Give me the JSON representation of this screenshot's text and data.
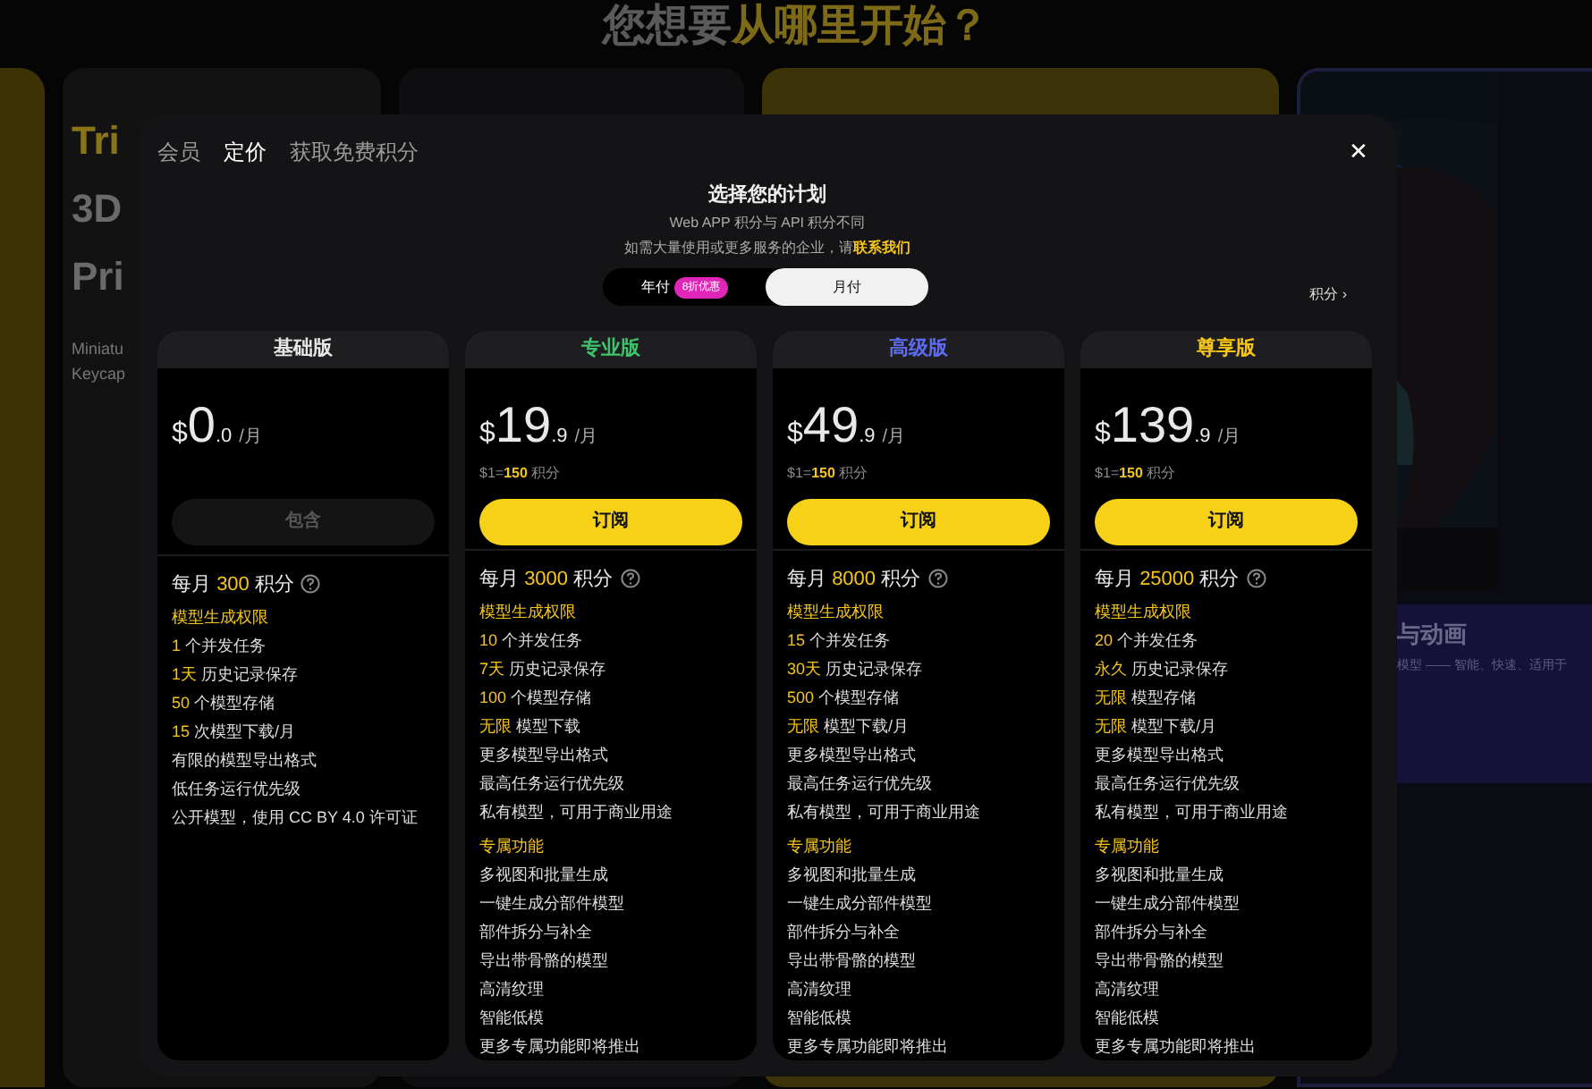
{
  "backdrop": {
    "heading": {
      "plain": "您想要",
      "highlight": "从哪里开始？"
    },
    "promo_lines": [
      "Tri",
      "3D",
      "Pri"
    ],
    "promo_caption": [
      "Miniatu",
      "Keycap"
    ],
    "feature_title": "与动画",
    "feature_subtitle": "模型 —— 智能、快速、适用于"
  },
  "modal": {
    "tabs": [
      {
        "label": "会员",
        "selected": false
      },
      {
        "label": "定价",
        "selected": true
      },
      {
        "label": "获取免费积分",
        "selected": false
      }
    ],
    "close": "✕",
    "title": "选择您的计划",
    "subtitle": "Web APP 积分与 API 积分不同",
    "contact": {
      "text": "如需大量使用或更多服务的企业，请",
      "link": "联系我们"
    },
    "billing": [
      {
        "label": "年付",
        "badge": "8折优惠",
        "selected": false
      },
      {
        "label": "月付",
        "selected": true
      }
    ],
    "credits_link": "积分 ›",
    "plans": [
      {
        "name": "基础版",
        "color": "#e6e6e6",
        "currency": "$",
        "price": "0",
        "decimals": ".0",
        "period": "/月",
        "button": {
          "label": "包含",
          "disabled": true
        },
        "features": [
          {
            "kind": "credits",
            "prefix": "每月",
            "value": "300",
            "suffix": "积分"
          },
          {
            "kind": "heading",
            "text": "模型生成权限"
          },
          {
            "kind": "feature",
            "value": "1",
            "text": "个并发任务"
          },
          {
            "kind": "feature",
            "value": "1天",
            "text": "历史记录保存"
          },
          {
            "kind": "feature",
            "value": "50",
            "text": "个模型存储"
          },
          {
            "kind": "feature",
            "value": "15",
            "text": "次模型下载/月"
          },
          {
            "kind": "feature",
            "text": "有限的模型导出格式"
          },
          {
            "kind": "feature",
            "text": "低任务运行优先级"
          },
          {
            "kind": "feature",
            "text": "公开模型，使用 CC BY 4.0 许可证"
          }
        ]
      },
      {
        "name": "专业版",
        "color": "#3ec36b",
        "currency": "$",
        "price": "19",
        "decimals": ".9",
        "period": "/月",
        "rate": {
          "prefix": "$1=",
          "value": "150",
          "suffix": "积分"
        },
        "button": {
          "label": "订阅",
          "disabled": false
        },
        "features": [
          {
            "kind": "credits",
            "prefix": "每月",
            "value": "3000",
            "suffix": "积分"
          },
          {
            "kind": "heading",
            "text": "模型生成权限"
          },
          {
            "kind": "feature",
            "value": "10",
            "text": "个并发任务"
          },
          {
            "kind": "feature",
            "value": "7天",
            "text": "历史记录保存"
          },
          {
            "kind": "feature",
            "value": "100",
            "text": "个模型存储"
          },
          {
            "kind": "feature",
            "value": "无限",
            "text": "模型下载"
          },
          {
            "kind": "feature",
            "text": "更多模型导出格式"
          },
          {
            "kind": "feature",
            "text": "最高任务运行优先级"
          },
          {
            "kind": "feature",
            "text": "私有模型，可用于商业用途"
          },
          {
            "kind": "heading",
            "text": "专属功能"
          },
          {
            "kind": "feature",
            "text": "多视图和批量生成"
          },
          {
            "kind": "feature",
            "text": "一键生成分部件模型"
          },
          {
            "kind": "feature",
            "text": "部件拆分与补全"
          },
          {
            "kind": "feature",
            "text": "导出带骨骼的模型"
          },
          {
            "kind": "feature",
            "text": "高清纹理"
          },
          {
            "kind": "feature",
            "text": "智能低模"
          },
          {
            "kind": "feature",
            "text": "更多专属功能即将推出"
          }
        ]
      },
      {
        "name": "高级版",
        "color": "#5d6cf0",
        "currency": "$",
        "price": "49",
        "decimals": ".9",
        "period": "/月",
        "rate": {
          "prefix": "$1=",
          "value": "150",
          "suffix": "积分"
        },
        "button": {
          "label": "订阅",
          "disabled": false
        },
        "features": [
          {
            "kind": "credits",
            "prefix": "每月",
            "value": "8000",
            "suffix": "积分"
          },
          {
            "kind": "heading",
            "text": "模型生成权限"
          },
          {
            "kind": "feature",
            "value": "15",
            "text": "个并发任务"
          },
          {
            "kind": "feature",
            "value": "30天",
            "text": "历史记录保存"
          },
          {
            "kind": "feature",
            "value": "500",
            "text": "个模型存储"
          },
          {
            "kind": "feature",
            "value": "无限",
            "text": "模型下载/月"
          },
          {
            "kind": "feature",
            "text": "更多模型导出格式"
          },
          {
            "kind": "feature",
            "text": "最高任务运行优先级"
          },
          {
            "kind": "feature",
            "text": "私有模型，可用于商业用途"
          },
          {
            "kind": "heading",
            "text": "专属功能"
          },
          {
            "kind": "feature",
            "text": "多视图和批量生成"
          },
          {
            "kind": "feature",
            "text": "一键生成分部件模型"
          },
          {
            "kind": "feature",
            "text": "部件拆分与补全"
          },
          {
            "kind": "feature",
            "text": "导出带骨骼的模型"
          },
          {
            "kind": "feature",
            "text": "高清纹理"
          },
          {
            "kind": "feature",
            "text": "智能低模"
          },
          {
            "kind": "feature",
            "text": "更多专属功能即将推出"
          }
        ]
      },
      {
        "name": "尊享版",
        "color": "#f5c518",
        "currency": "$",
        "price": "139",
        "decimals": ".9",
        "period": "/月",
        "rate": {
          "prefix": "$1=",
          "value": "150",
          "suffix": "积分"
        },
        "button": {
          "label": "订阅",
          "disabled": false
        },
        "features": [
          {
            "kind": "credits",
            "prefix": "每月",
            "value": "25000",
            "suffix": "积分"
          },
          {
            "kind": "heading",
            "text": "模型生成权限"
          },
          {
            "kind": "feature",
            "value": "20",
            "text": "个并发任务"
          },
          {
            "kind": "feature",
            "value": "永久",
            "text": "历史记录保存"
          },
          {
            "kind": "feature",
            "value": "无限",
            "text": "模型存储"
          },
          {
            "kind": "feature",
            "value": "无限",
            "text": "模型下载/月"
          },
          {
            "kind": "feature",
            "text": "更多模型导出格式"
          },
          {
            "kind": "feature",
            "text": "最高任务运行优先级"
          },
          {
            "kind": "feature",
            "text": "私有模型，可用于商业用途"
          },
          {
            "kind": "heading",
            "text": "专属功能"
          },
          {
            "kind": "feature",
            "text": "多视图和批量生成"
          },
          {
            "kind": "feature",
            "text": "一键生成分部件模型"
          },
          {
            "kind": "feature",
            "text": "部件拆分与补全"
          },
          {
            "kind": "feature",
            "text": "导出带骨骼的模型"
          },
          {
            "kind": "feature",
            "text": "高清纹理"
          },
          {
            "kind": "feature",
            "text": "智能低模"
          },
          {
            "kind": "feature",
            "text": "更多专属功能即将推出"
          }
        ]
      }
    ]
  }
}
